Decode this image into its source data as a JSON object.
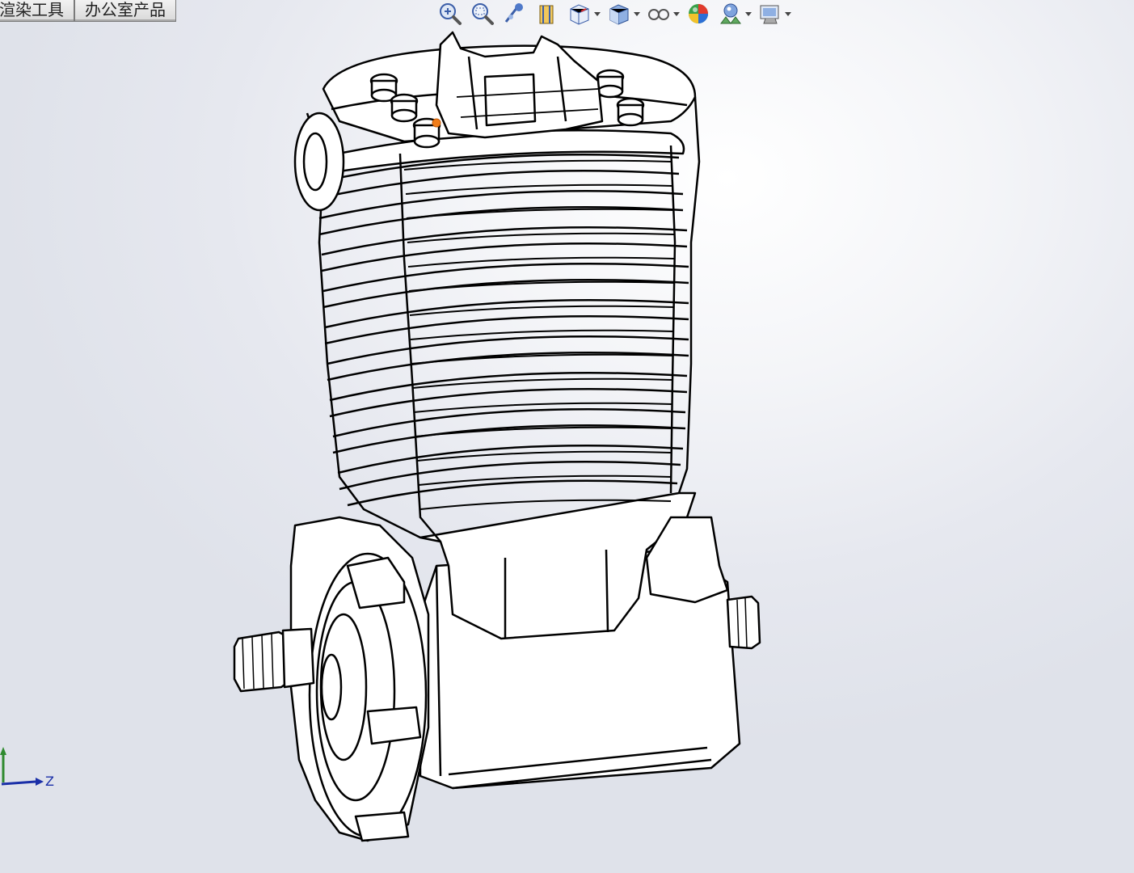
{
  "tabs": [
    {
      "label": "渲染工具"
    },
    {
      "label": "办公室产品"
    }
  ],
  "heads_up_toolbar": {
    "buttons": [
      {
        "icon": "zoom-to-fit-icon"
      },
      {
        "icon": "zoom-to-area-icon"
      },
      {
        "icon": "previous-view-icon"
      },
      {
        "icon": "section-view-icon"
      },
      {
        "icon": "view-orientation-icon",
        "has_menu": true
      },
      {
        "icon": "display-style-icon",
        "has_menu": true
      },
      {
        "icon": "hide-show-items-icon",
        "has_menu": true
      },
      {
        "icon": "edit-appearance-icon"
      },
      {
        "icon": "apply-scene-icon",
        "has_menu": true
      },
      {
        "icon": "view-settings-icon",
        "has_menu": true
      }
    ]
  },
  "graphics_area": {
    "model": "single-cylinder-engine-wireframe",
    "display_style": "hidden-lines-removed",
    "triad_axis_label": "Z"
  },
  "colors": {
    "background_light": "#ffffff",
    "background_dark": "#dfe2ea",
    "edge_color": "#000000",
    "triad_z": "#1a2fa8",
    "triad_y": "#2f8a2f"
  }
}
